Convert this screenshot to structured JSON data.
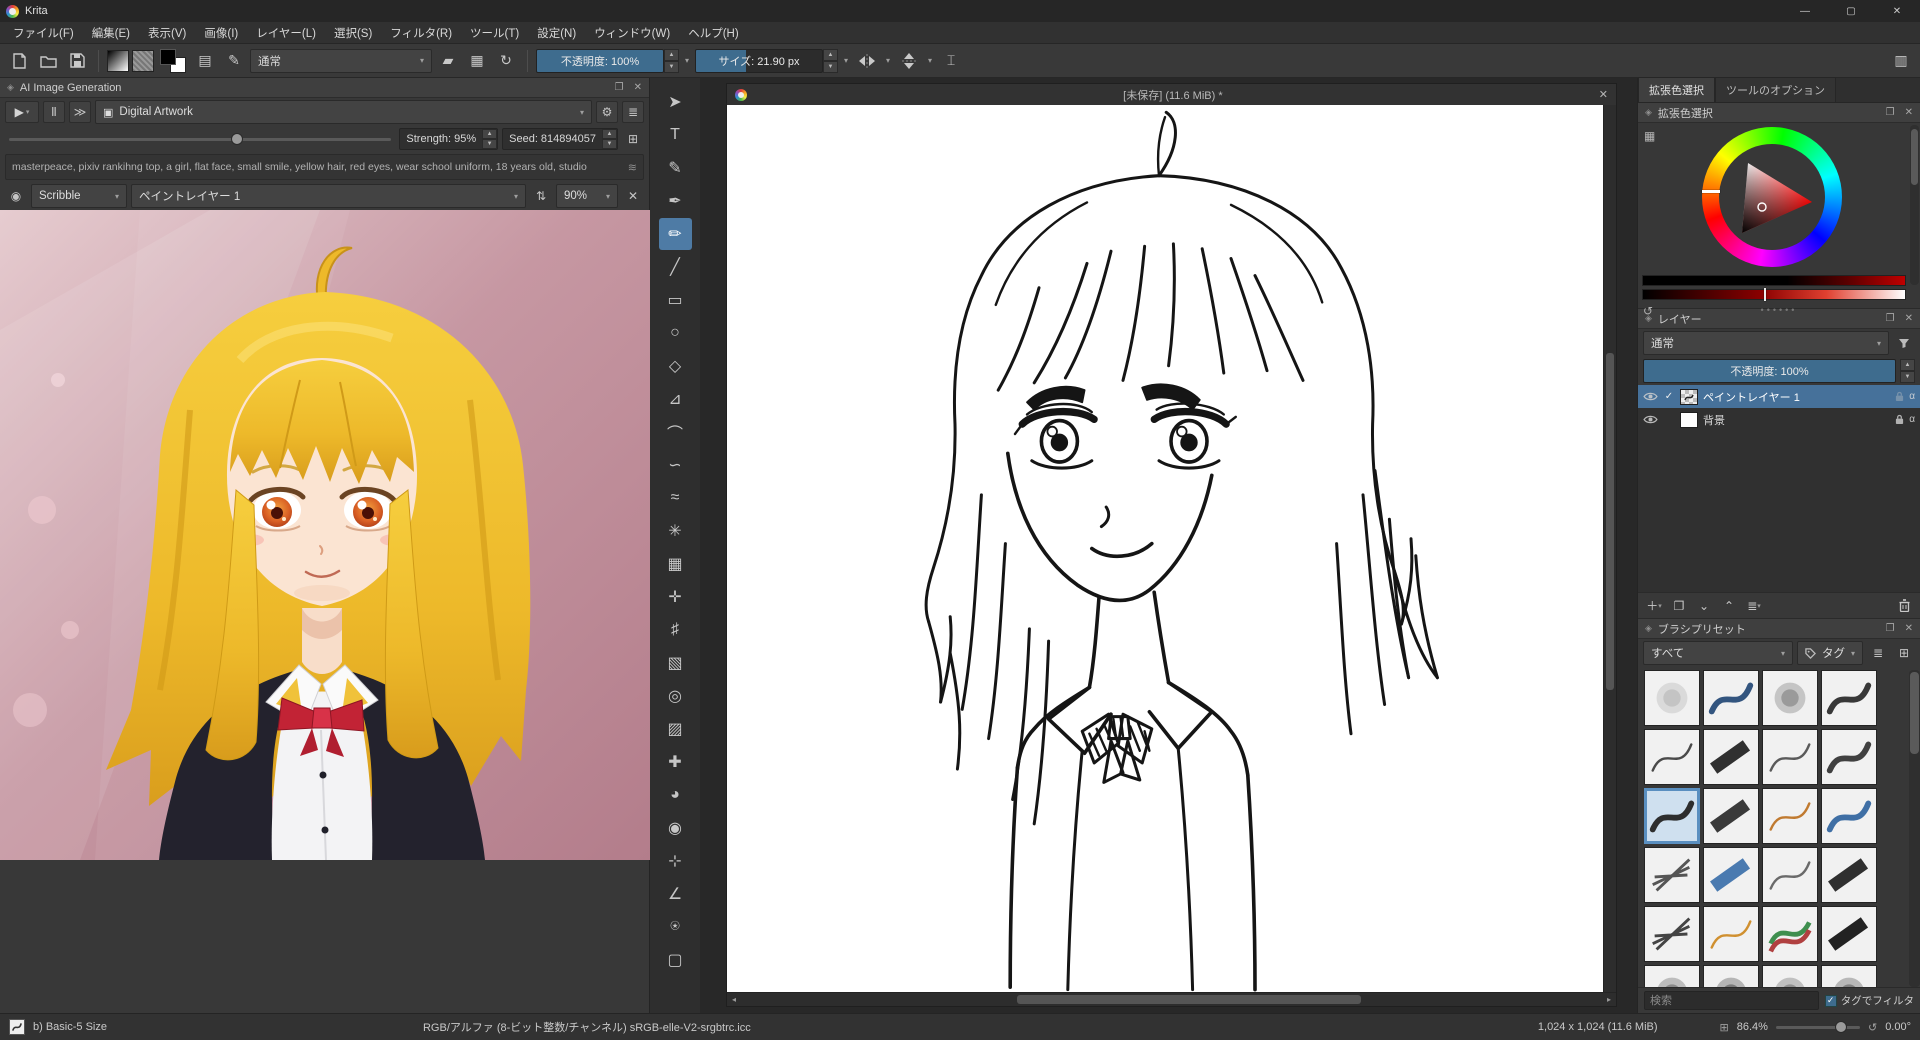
{
  "accent": "#3e6c8e",
  "window": {
    "title": "Krita"
  },
  "menu": {
    "items": [
      {
        "id": "file",
        "label": "ファイル(F)"
      },
      {
        "id": "edit",
        "label": "編集(E)"
      },
      {
        "id": "view",
        "label": "表示(V)"
      },
      {
        "id": "image",
        "label": "画像(I)"
      },
      {
        "id": "layer",
        "label": "レイヤー(L)"
      },
      {
        "id": "select",
        "label": "選択(S)"
      },
      {
        "id": "filter",
        "label": "フィルタ(R)"
      },
      {
        "id": "tools",
        "label": "ツール(T)"
      },
      {
        "id": "settings",
        "label": "設定(N)"
      },
      {
        "id": "window",
        "label": "ウィンドウ(W)"
      },
      {
        "id": "help",
        "label": "ヘルプ(H)"
      }
    ]
  },
  "toolbar": {
    "blend_mode": "通常",
    "opacity": "不透明度: 100%",
    "size": "サイズ: 21.90 px"
  },
  "ai": {
    "title": "AI Image Generation",
    "preset": "Digital Artwork",
    "strength": "Strength: 95%",
    "seed": "Seed: 814894057",
    "prompt": "masterpeace, pixiv rankihng top,  a girl, flat face, small smile,  yellow hair, red eyes, wear school uniform, 18 years old, studio",
    "mode": "Scribble",
    "layer": "ペイントレイヤー 1",
    "percent": "90%"
  },
  "toolbox": {
    "tools": [
      {
        "id": "select-shapes",
        "glyph": "➤",
        "selected": false
      },
      {
        "id": "text",
        "glyph": "T",
        "selected": false
      },
      {
        "id": "edit-shapes",
        "glyph": "✎",
        "selected": false
      },
      {
        "id": "calligraphy",
        "glyph": "✒",
        "selected": false
      },
      {
        "id": "freehand-brush",
        "glyph": "✏",
        "selected": true
      },
      {
        "id": "line",
        "glyph": "╱",
        "selected": false
      },
      {
        "id": "rectangle",
        "glyph": "▭",
        "selected": false
      },
      {
        "id": "ellipse",
        "glyph": "○",
        "selected": false
      },
      {
        "id": "polygon",
        "glyph": "◇",
        "selected": false
      },
      {
        "id": "polyline",
        "glyph": "⊿",
        "selected": false
      },
      {
        "id": "bezier-curve",
        "glyph": "⌒",
        "selected": false
      },
      {
        "id": "freehand-path",
        "glyph": "∽",
        "selected": false
      },
      {
        "id": "dynamic-brush",
        "glyph": "≈",
        "selected": false
      },
      {
        "id": "multibrush",
        "glyph": "✳",
        "selected": false
      },
      {
        "id": "transform",
        "glyph": "▦",
        "selected": false
      },
      {
        "id": "move",
        "glyph": "✛",
        "selected": false
      },
      {
        "id": "crop",
        "glyph": "♯",
        "selected": false
      },
      {
        "id": "gradient",
        "glyph": "▧",
        "selected": false
      },
      {
        "id": "color-sampler",
        "glyph": "◎",
        "selected": false
      },
      {
        "id": "pattern-edit",
        "glyph": "▨",
        "selected": false
      },
      {
        "id": "smart-patch",
        "glyph": "✚",
        "selected": false
      },
      {
        "id": "fill",
        "glyph": "◕",
        "selected": false
      },
      {
        "id": "enclose-fill",
        "glyph": "◉",
        "selected": false
      },
      {
        "id": "assistants",
        "glyph": "⊹",
        "selected": false
      },
      {
        "id": "measure",
        "glyph": "∠",
        "selected": false
      },
      {
        "id": "reference-images",
        "glyph": "⍟",
        "selected": false
      },
      {
        "id": "rectangular-selection",
        "glyph": "▢",
        "selected": false
      }
    ]
  },
  "canvas": {
    "title": "[未保存] (11.6 MiB) *"
  },
  "right": {
    "tabs": [
      {
        "id": "advanced-color",
        "label": "拡張色選択",
        "active": true
      },
      {
        "id": "tool-options",
        "label": "ツールのオプション",
        "active": false
      }
    ],
    "color": {
      "title": "拡張色選択"
    },
    "layers": {
      "title": "レイヤー",
      "blend": "通常",
      "opacity": "不透明度: 100%",
      "items": [
        {
          "name": "ペイントレイヤー 1",
          "selected": true,
          "thumb": "sketch",
          "locked": false
        },
        {
          "name": "背景",
          "selected": false,
          "thumb": "white",
          "locked": true
        }
      ]
    },
    "presets": {
      "title": "ブラシプリセット",
      "filter": "すべて",
      "tag": "タグ",
      "search_placeholder": "検索",
      "tag_filter": "タグでフィルタ",
      "items": [
        {
          "id": "eraser-soft",
          "k": 2,
          "c": "#c4c4c4"
        },
        {
          "id": "ink-pen-blue",
          "k": 0,
          "c": "#33557f"
        },
        {
          "id": "soft-round",
          "k": 2,
          "c": "#9a9a9a"
        },
        {
          "id": "ink-brush",
          "k": 0,
          "c": "#383838"
        },
        {
          "id": "pencil-hb",
          "k": 1,
          "c": "#4a4a4a"
        },
        {
          "id": "marker-dark",
          "k": 3,
          "c": "#303030"
        },
        {
          "id": "pencil-soft",
          "k": 1,
          "c": "#5a5a5a"
        },
        {
          "id": "ink-rough",
          "k": 0,
          "c": "#404040"
        },
        {
          "id": "basic-5-size",
          "k": 0,
          "c": "#2e2e2e",
          "selected": true
        },
        {
          "id": "marker-chisel",
          "k": 3,
          "c": "#3a3a3a"
        },
        {
          "id": "pencil-orange",
          "k": 1,
          "c": "#c07a30"
        },
        {
          "id": "pen-blue",
          "k": 0,
          "c": "#3f6fa5"
        },
        {
          "id": "scratchy",
          "k": 4,
          "c": "#555555"
        },
        {
          "id": "marker-blue",
          "k": 3,
          "c": "#4a7ab0"
        },
        {
          "id": "pencil-gray",
          "k": 1,
          "c": "#6a6a6a"
        },
        {
          "id": "marker-flat",
          "k": 3,
          "c": "#2f2f2f"
        },
        {
          "id": "charcoal",
          "k": 4,
          "c": "#444444"
        },
        {
          "id": "pencil-yellow",
          "k": 1,
          "c": "#d09030"
        },
        {
          "id": "pencil-duo",
          "k": 5,
          "c": "#3f8f4f"
        },
        {
          "id": "marker-black",
          "k": 3,
          "c": "#222222"
        },
        {
          "id": "soft-a",
          "k": 2,
          "c": "#8a8a8a"
        },
        {
          "id": "soft-b",
          "k": 2,
          "c": "#7a7a7a"
        },
        {
          "id": "soft-c",
          "k": 2,
          "c": "#909090"
        },
        {
          "id": "soft-d",
          "k": 2,
          "c": "#808080"
        }
      ]
    }
  },
  "statusbar": {
    "brush": "b) Basic-5 Size",
    "color_profile": "RGB/アルファ (8-ビット整数/チャンネル)  sRGB-elle-V2-srgbtrc.icc",
    "dims": "1,024 x 1,024 (11.6 MiB)",
    "zoom": "86.4%",
    "angle": "0.00°"
  }
}
